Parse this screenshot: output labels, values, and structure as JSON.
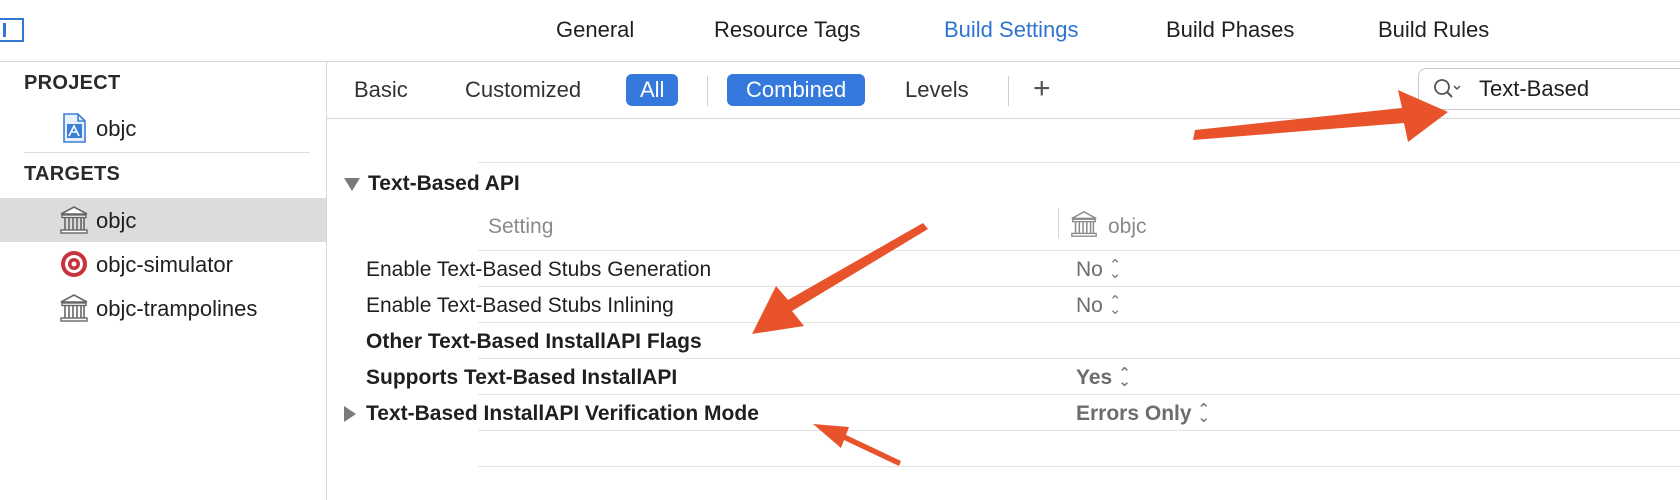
{
  "top_tabs": {
    "general": "General",
    "resource_tags": "Resource Tags",
    "build_settings": "Build Settings",
    "build_phases": "Build Phases",
    "build_rules": "Build Rules"
  },
  "navigator": {
    "project_header": "PROJECT",
    "project_item": "objc",
    "targets_header": "TARGETS",
    "targets": [
      "objc",
      "objc-simulator",
      "objc-trampolines"
    ]
  },
  "filter_bar": {
    "basic": "Basic",
    "customized": "Customized",
    "all": "All",
    "combined": "Combined",
    "levels": "Levels",
    "add": "+"
  },
  "search": {
    "value": "Text-Based"
  },
  "settings_group": {
    "title": "Text-Based API",
    "col_setting": "Setting",
    "col_target": "objc",
    "rows": [
      {
        "label": "Enable Text-Based Stubs Generation",
        "value": "No"
      },
      {
        "label": "Enable Text-Based Stubs Inlining",
        "value": "No"
      },
      {
        "label": "Other Text-Based InstallAPI Flags",
        "value": ""
      },
      {
        "label": "Supports Text-Based InstallAPI",
        "value": "Yes"
      },
      {
        "label": "Text-Based InstallAPI Verification Mode",
        "value": "Errors Only"
      }
    ]
  },
  "colors": {
    "accent": "#3479db",
    "annotation_arrow": "#e8532b"
  }
}
